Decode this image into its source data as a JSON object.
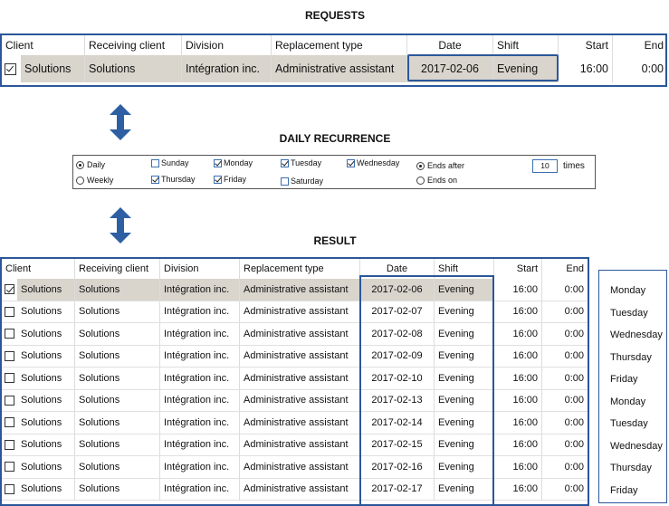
{
  "titles": {
    "requests": "REQUESTS",
    "daily_recurrence": "DAILY RECURRENCE",
    "result": "RESULT"
  },
  "columns": [
    "Client",
    "Receiving client",
    "Division",
    "Replacement type",
    "Date",
    "Shift",
    "Start",
    "End"
  ],
  "request": {
    "checked": true,
    "client": "Solutions",
    "receiving_client": "Solutions",
    "division": "Intégration inc.",
    "replacement_type": "Administrative assistant",
    "date": "2017-02-06",
    "shift": "Evening",
    "start": "16:00",
    "end": "0:00"
  },
  "recurrence": {
    "daily": {
      "label": "Daily",
      "selected": true
    },
    "weekly": {
      "label": "Weekly",
      "selected": false
    },
    "sunday": {
      "label": "Sunday",
      "checked": false
    },
    "monday": {
      "label": "Monday",
      "checked": true
    },
    "tuesday": {
      "label": "Tuesday",
      "checked": true
    },
    "wednesday": {
      "label": "Wednesday",
      "checked": true
    },
    "thursday": {
      "label": "Thursday",
      "checked": true
    },
    "friday": {
      "label": "Friday",
      "checked": true
    },
    "saturday": {
      "label": "Saturday",
      "checked": false
    },
    "ends_after": {
      "label": "Ends after",
      "selected": true
    },
    "ends_on": {
      "label": "Ends on",
      "selected": false
    },
    "times_value": "10",
    "times_label": "times"
  },
  "results": [
    {
      "checked": true,
      "client": "Solutions",
      "receiving_client": "Solutions",
      "division": "Intégration inc.",
      "replacement_type": "Administrative assistant",
      "date": "2017-02-06",
      "shift": "Evening",
      "start": "16:00",
      "end": "0:00",
      "weekday": "Monday"
    },
    {
      "checked": false,
      "client": "Solutions",
      "receiving_client": "Solutions",
      "division": "Intégration inc.",
      "replacement_type": "Administrative assistant",
      "date": "2017-02-07",
      "shift": "Evening",
      "start": "16:00",
      "end": "0:00",
      "weekday": "Tuesday"
    },
    {
      "checked": false,
      "client": "Solutions",
      "receiving_client": "Solutions",
      "division": "Intégration inc.",
      "replacement_type": "Administrative assistant",
      "date": "2017-02-08",
      "shift": "Evening",
      "start": "16:00",
      "end": "0:00",
      "weekday": "Wednesday"
    },
    {
      "checked": false,
      "client": "Solutions",
      "receiving_client": "Solutions",
      "division": "Intégration inc.",
      "replacement_type": "Administrative assistant",
      "date": "2017-02-09",
      "shift": "Evening",
      "start": "16:00",
      "end": "0:00",
      "weekday": "Thursday"
    },
    {
      "checked": false,
      "client": "Solutions",
      "receiving_client": "Solutions",
      "division": "Intégration inc.",
      "replacement_type": "Administrative assistant",
      "date": "2017-02-10",
      "shift": "Evening",
      "start": "16:00",
      "end": "0:00",
      "weekday": "Friday"
    },
    {
      "checked": false,
      "client": "Solutions",
      "receiving_client": "Solutions",
      "division": "Intégration inc.",
      "replacement_type": "Administrative assistant",
      "date": "2017-02-13",
      "shift": "Evening",
      "start": "16:00",
      "end": "0:00",
      "weekday": "Monday"
    },
    {
      "checked": false,
      "client": "Solutions",
      "receiving_client": "Solutions",
      "division": "Intégration inc.",
      "replacement_type": "Administrative assistant",
      "date": "2017-02-14",
      "shift": "Evening",
      "start": "16:00",
      "end": "0:00",
      "weekday": "Tuesday"
    },
    {
      "checked": false,
      "client": "Solutions",
      "receiving_client": "Solutions",
      "division": "Intégration inc.",
      "replacement_type": "Administrative assistant",
      "date": "2017-02-15",
      "shift": "Evening",
      "start": "16:00",
      "end": "0:00",
      "weekday": "Wednesday"
    },
    {
      "checked": false,
      "client": "Solutions",
      "receiving_client": "Solutions",
      "division": "Intégration inc.",
      "replacement_type": "Administrative assistant",
      "date": "2017-02-16",
      "shift": "Evening",
      "start": "16:00",
      "end": "0:00",
      "weekday": "Thursday"
    },
    {
      "checked": false,
      "client": "Solutions",
      "receiving_client": "Solutions",
      "division": "Intégration inc.",
      "replacement_type": "Administrative assistant",
      "date": "2017-02-17",
      "shift": "Evening",
      "start": "16:00",
      "end": "0:00",
      "weekday": "Friday"
    }
  ],
  "colors": {
    "accent": "#2b579a",
    "selected_row": "#d9d4cc",
    "arrow": "#2e5fa3"
  },
  "icons": {
    "arrow": "double-headed-vertical-arrow-icon"
  }
}
